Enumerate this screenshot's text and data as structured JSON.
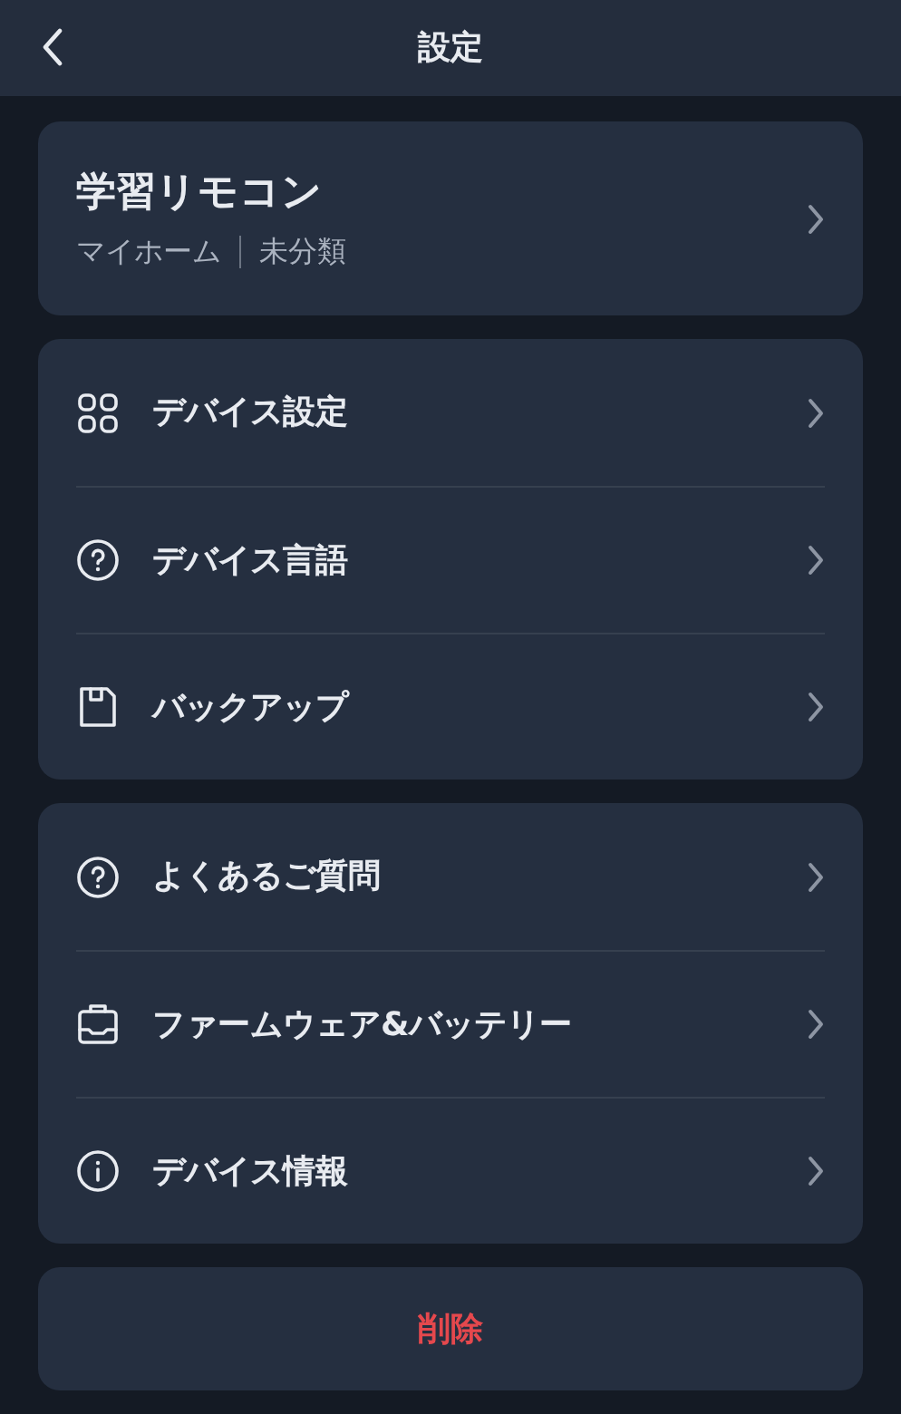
{
  "header": {
    "title": "設定"
  },
  "device": {
    "name": "学習リモコン",
    "home": "マイホーム",
    "category": "未分類"
  },
  "groups": [
    [
      {
        "kind": "grid",
        "label": "デバイス設定"
      },
      {
        "kind": "help",
        "label": "デバイス言語"
      },
      {
        "kind": "backup",
        "label": "バックアップ"
      }
    ],
    [
      {
        "kind": "help",
        "label": "よくあるご質問"
      },
      {
        "kind": "firmware",
        "label": "ファームウェア&バッテリー"
      },
      {
        "kind": "info",
        "label": "デバイス情報"
      }
    ]
  ],
  "delete_button": "削除"
}
